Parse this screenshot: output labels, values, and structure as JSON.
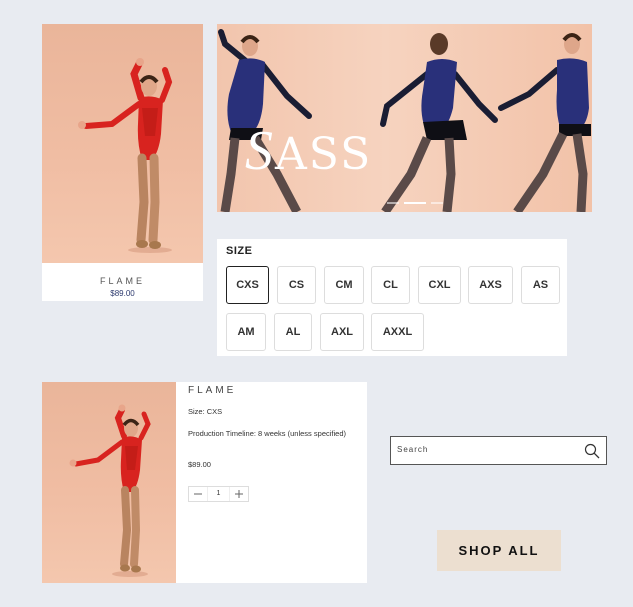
{
  "product_card": {
    "name": "FLAME",
    "price": "$89.00",
    "image": "dancer in red sequin leotard"
  },
  "banner": {
    "headline": "SASS",
    "headline_first": "S",
    "headline_rest": "ASS",
    "image": "three dancers in black and blue leotards",
    "slides": 3,
    "active_slide": 1
  },
  "size_selector": {
    "label": "SIZE",
    "selected": "CXS",
    "options": [
      "CXS",
      "CS",
      "CM",
      "CL",
      "CXL",
      "AXS",
      "AS",
      "AM",
      "AL",
      "AXL",
      "AXXL"
    ]
  },
  "cart_item": {
    "name": "FLAME",
    "size_line": "Size: CXS",
    "timeline_line": "Production Timeline: 8 weeks (unless specified)",
    "price": "$89.00",
    "quantity": "1",
    "minus_icon": "minus-icon",
    "plus_icon": "plus-icon"
  },
  "search": {
    "placeholder": "Search",
    "icon": "search-icon"
  },
  "shop_all": {
    "label": "SHOP ALL"
  },
  "colors": {
    "page_bg": "#e8ebf1",
    "photo_bg": "#f0bda3",
    "leotard_red": "#d8231f",
    "price_blue": "#2d3a6e",
    "shop_all_bg": "#ecdfd0"
  }
}
